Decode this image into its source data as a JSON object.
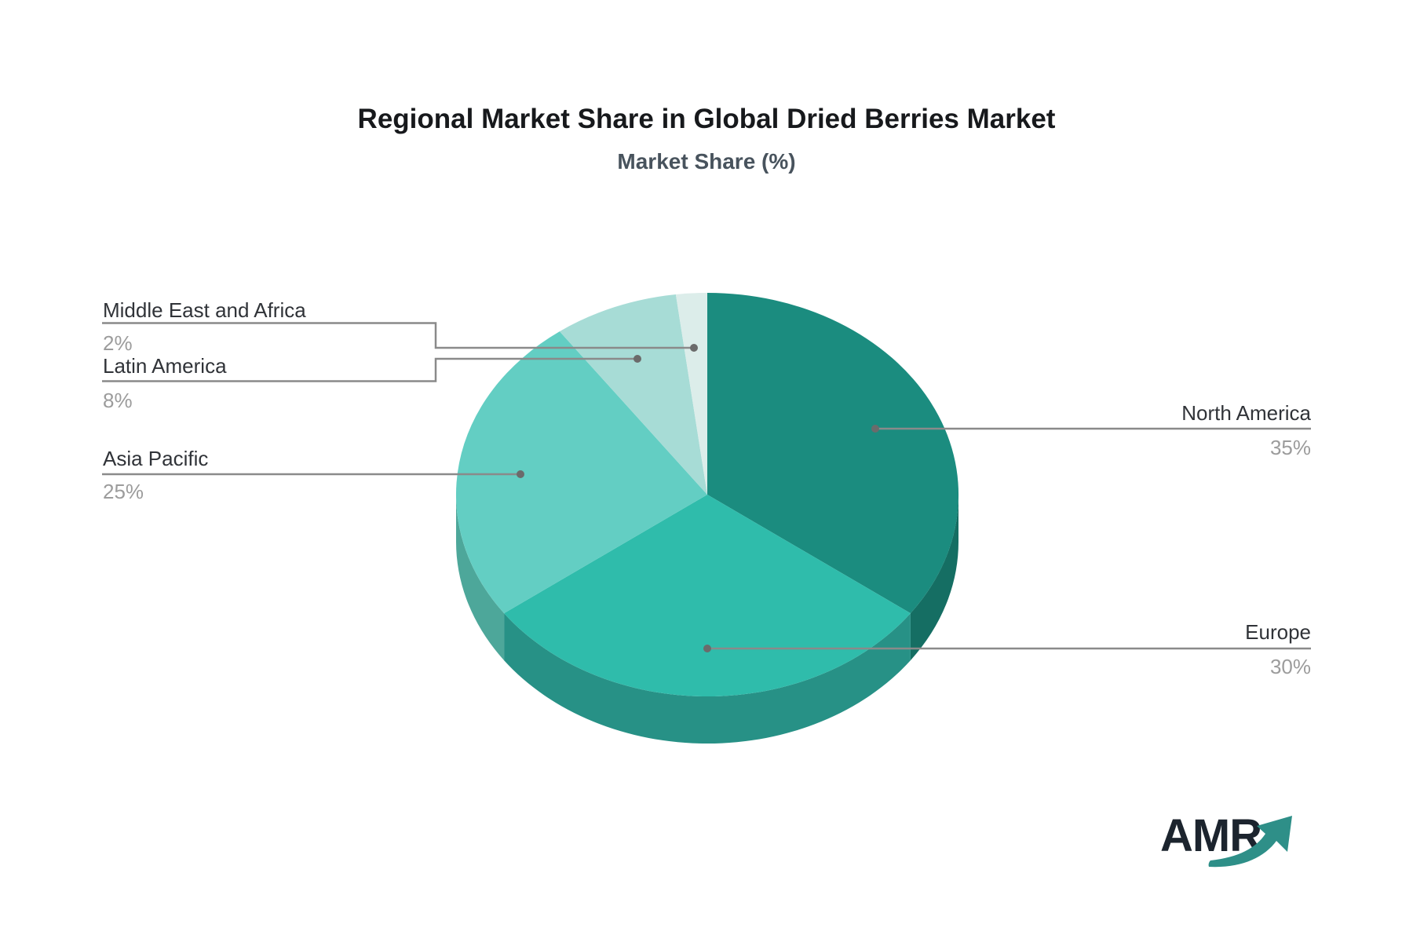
{
  "style": {
    "leader_color": "#8A8A8A",
    "dot_color": "#6B6B6B",
    "label_color": "#303338",
    "value_color": "#9C9C9C",
    "title_color": "#17191C",
    "subtitle_color": "#48535D",
    "logo_text_color": "#1C242E",
    "logo_arrow_color": "#2E8F88",
    "background": "#FFFFFF"
  },
  "logo": {
    "text": "AMR"
  },
  "chart_data": {
    "type": "pie",
    "title": "Regional Market Share in Global Dried Berries Market",
    "subtitle": "Market Share (%)",
    "unit": "%",
    "direction": "clockwise",
    "start_angle_deg": 0,
    "effect": "pseudo-3d",
    "legend": "none",
    "slices": [
      {
        "label": "North America",
        "value": 35,
        "display": "35%",
        "color": "#1B8C7F",
        "side_color": "#156E63"
      },
      {
        "label": "Europe",
        "value": 30,
        "display": "30%",
        "color": "#2FBCAB",
        "side_color": "#279186"
      },
      {
        "label": "Asia Pacific",
        "value": 25,
        "display": "25%",
        "color": "#63CEC3",
        "side_color": "#4DA79A"
      },
      {
        "label": "Latin America",
        "value": 8,
        "display": "8%",
        "color": "#A7DCD6",
        "side_color": "#84BDB4"
      },
      {
        "label": "Middle East and Africa",
        "value": 2,
        "display": "2%",
        "color": "#DCEDEA",
        "side_color": "#B3CCC7"
      }
    ]
  }
}
